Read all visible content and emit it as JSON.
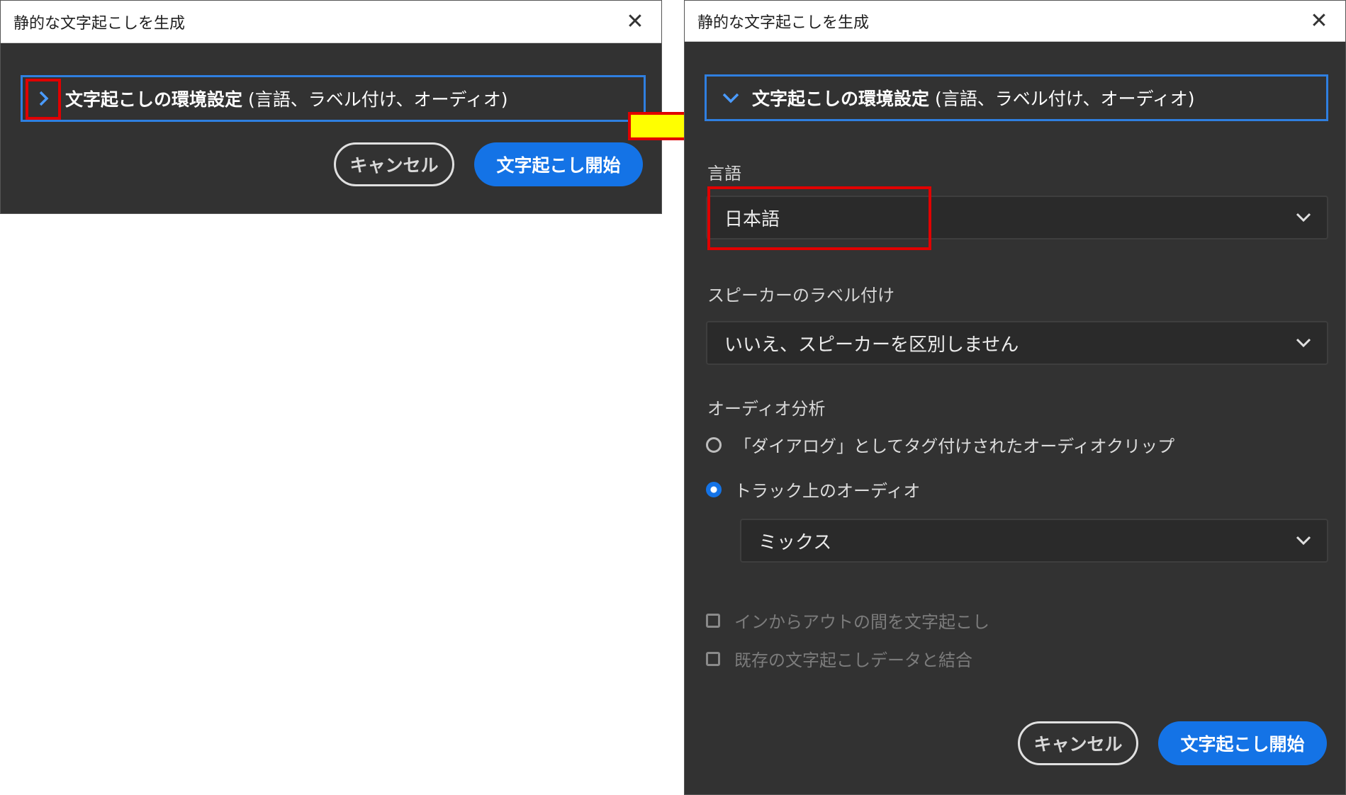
{
  "dialog_collapsed": {
    "title": "静的な文字起こしを生成",
    "section_title_bold": "文字起こしの環境設定",
    "section_title_rest": " (言語、ラベル付け、オーディオ)",
    "cancel_label": "キャンセル",
    "start_label": "文字起こし開始"
  },
  "dialog_expanded": {
    "title": "静的な文字起こしを生成",
    "section_title_bold": "文字起こしの環境設定",
    "section_title_rest": " (言語、ラベル付け、オーディオ)",
    "language": {
      "label": "言語",
      "value": "日本語"
    },
    "speaker_labeling": {
      "label": "スピーカーのラベル付け",
      "value": "いいえ、スピーカーを区別しません"
    },
    "audio_analysis": {
      "label": "オーディオ分析",
      "options": [
        {
          "label": "「ダイアログ」としてタグ付けされたオーディオクリップ",
          "selected": false
        },
        {
          "label": "トラック上のオーディオ",
          "selected": true
        }
      ],
      "track_value": "ミックス"
    },
    "checkboxes": [
      {
        "label": "インからアウトの間を文字起こし",
        "checked": false,
        "disabled": true
      },
      {
        "label": "既存の文字起こしデータと結合",
        "checked": false,
        "disabled": true
      }
    ],
    "cancel_label": "キャンセル",
    "start_label": "文字起こし開始"
  },
  "colors": {
    "dialog_bg": "#323232",
    "accent_blue": "#1473e6",
    "highlight_red": "#e00000",
    "arrow_yellow": "#ffff00"
  },
  "icons": {
    "close": "close-icon",
    "expand": "chevron-right-icon",
    "collapse": "chevron-down-icon",
    "dropdown": "chevron-down-icon",
    "pointer": "arrow-right-icon"
  }
}
